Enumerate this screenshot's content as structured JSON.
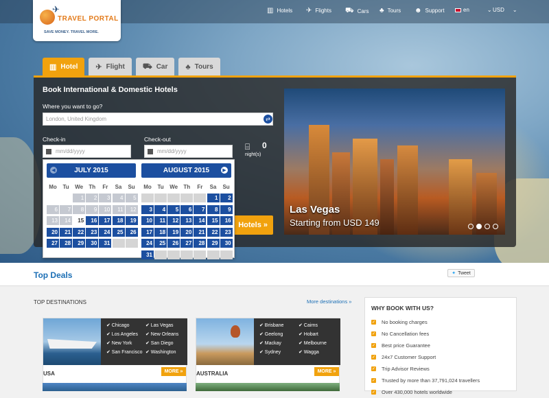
{
  "brand": {
    "name": "TRAVEL PORTAL",
    "tagline": "SAVE MONEY. TRAVEL MORE."
  },
  "nav": [
    {
      "label": "Hotels",
      "icon": "hotel-icon"
    },
    {
      "label": "Flights",
      "icon": "plane-icon"
    },
    {
      "label": "Cars",
      "icon": "car-icon"
    },
    {
      "label": "Tours",
      "icon": "palm-icon"
    },
    {
      "label": "Support",
      "icon": "support-icon"
    },
    {
      "label": "en",
      "icon": "flag-icon"
    },
    {
      "label": "USD",
      "icon": "chevron-down-icon"
    }
  ],
  "tabs": [
    {
      "label": "Hotel",
      "active": true
    },
    {
      "label": "Flight",
      "active": false
    },
    {
      "label": "Car",
      "active": false
    },
    {
      "label": "Tours",
      "active": false
    }
  ],
  "booking": {
    "title": "Book International & Domestic Hotels",
    "where_label": "Where you want to go?",
    "where_value": "London, United Kingdom",
    "checkin_label": "Check-in",
    "checkout_label": "Check-out",
    "date_placeholder": "mm/dd/yyyy",
    "nights_count": "0",
    "nights_label": "night(s)",
    "search_label": "Hotels »"
  },
  "promo": {
    "title": "Las Vegas",
    "subtitle": "Starting from USD 149",
    "slides": 4,
    "active_slide": 2
  },
  "calendar": {
    "weekdays": [
      "Mo",
      "Tu",
      "We",
      "Th",
      "Fr",
      "Sa",
      "Su"
    ],
    "months": [
      {
        "title": "JULY 2015",
        "first_weekday": 2,
        "days": 31,
        "today": 15
      },
      {
        "title": "AUGUST 2015",
        "first_weekday": 5,
        "days": 31,
        "today": 0
      }
    ]
  },
  "top_deals": {
    "title": "Top Deals",
    "tweet_label": "Tweet"
  },
  "destinations": {
    "title": "TOP DESTINATIONS",
    "more_label": "More destinations »",
    "cards": [
      {
        "name": "USA",
        "more": "MORE »",
        "cities": [
          "Chicago",
          "Las Vegas",
          "Los Angeles",
          "New Orleans",
          "New York",
          "San Diego",
          "San Francisco",
          "Washington"
        ]
      },
      {
        "name": "AUSTRALIA",
        "more": "MORE »",
        "cities": [
          "Brisbane",
          "Cairns",
          "Geelong",
          "Hobart",
          "Mackay",
          "Melbourne",
          "Sydney",
          "Wagga"
        ]
      }
    ]
  },
  "why": {
    "title": "WHY BOOK WITH US?",
    "items": [
      "No booking charges",
      "No Cancellation fees",
      "Best price Guarantee",
      "24x7 Customer Support",
      "Trip Advisor Reviews",
      "Trusted by more than 37,791,024 travellers",
      "Over 430,000 hotels worldwide"
    ]
  }
}
